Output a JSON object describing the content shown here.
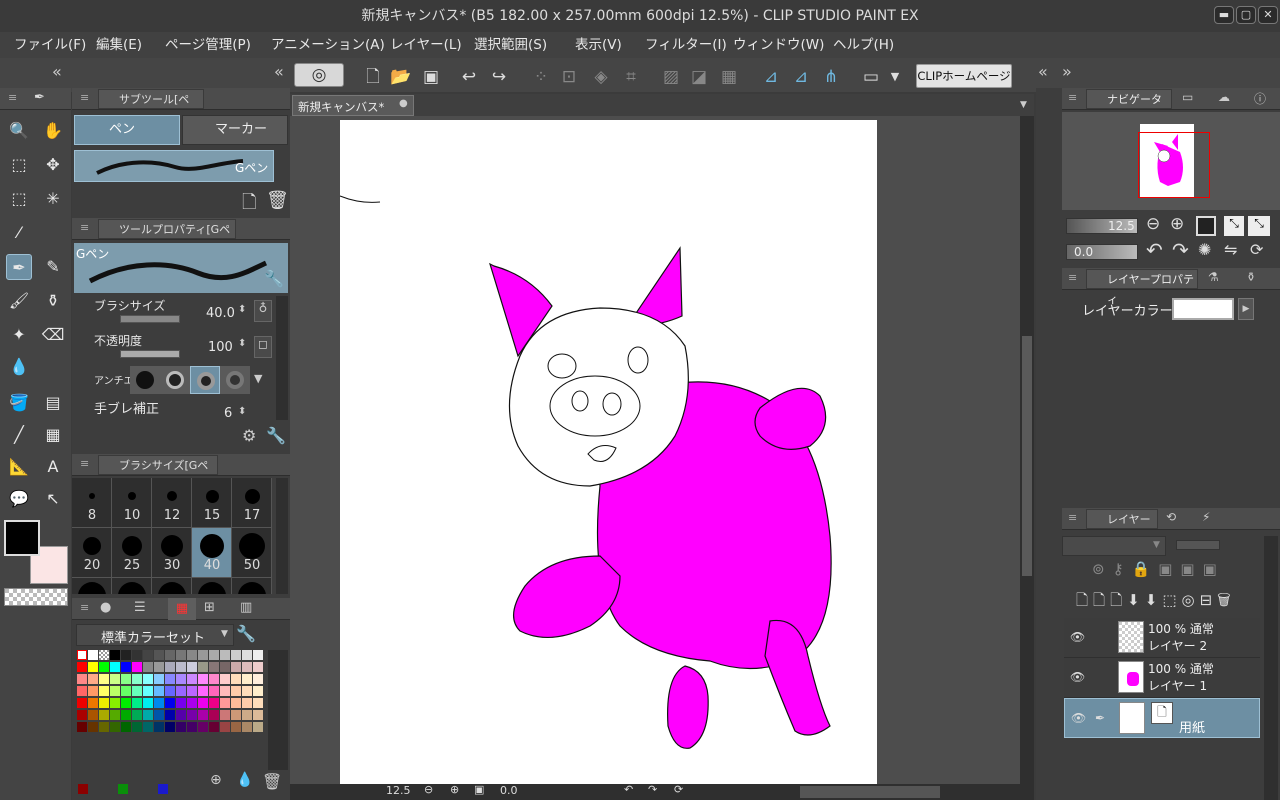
{
  "window": {
    "title": "新規キャンバス* (B5 182.00 x 257.00mm 600dpi 12.5%)  - CLIP STUDIO PAINT EX",
    "min": "▬",
    "max": "▢",
    "close": "✕"
  },
  "menu": [
    "ファイル(F)",
    "編集(E)",
    "ページ管理(P)",
    "アニメーション(A)",
    "レイヤー(L)",
    "選択範囲(S)",
    "表示(V)",
    "フィルター(I)",
    "ウィンドウ(W)",
    "ヘルプ(H)"
  ],
  "toolbar": {
    "clip_button": "CLIPホームページ"
  },
  "document_tab": {
    "label": "新規キャンバス*"
  },
  "subtool": {
    "header": "サブツール[ペン]",
    "tab_pen": "ペン",
    "tab_marker": "マーカー",
    "brush_name": "Gペン"
  },
  "tool_property": {
    "header": "ツールプロパティ[Gペン]",
    "brush_name": "Gペン",
    "brush_size_label": "ブラシサイズ",
    "brush_size_value": "40.0",
    "opacity_label": "不透明度",
    "opacity_value": "100",
    "antialias_label": "アンチエ",
    "stabilization_label": "手ブレ補正",
    "stabilization_value": "6"
  },
  "brush_size_panel": {
    "header": "ブラシサイズ[Gペン]",
    "sizes": [
      "8",
      "10",
      "12",
      "15",
      "17",
      "20",
      "25",
      "30",
      "40",
      "50"
    ],
    "selected": "40"
  },
  "color_set": {
    "name": "標準カラーセット"
  },
  "navigator": {
    "header": "ナビゲーター",
    "zoom": "12.5",
    "angle": "0.0"
  },
  "layer_property": {
    "header": "レイヤープロパティ",
    "layer_color_label": "レイヤーカラー"
  },
  "layers": {
    "header": "レイヤー",
    "items": [
      {
        "blend": "100 % 通常",
        "name": "レイヤー 2"
      },
      {
        "blend": "100 % 通常",
        "name": "レイヤー 1"
      },
      {
        "blend": "",
        "name": "用紙"
      }
    ]
  },
  "statusbar": {
    "zoom": "12.5",
    "angle": "0.0"
  },
  "colors": {
    "accent": "#6d8fa3",
    "pig": "#ff00ff",
    "main_color": "#000000",
    "sub_color": "#fbe5e5"
  }
}
